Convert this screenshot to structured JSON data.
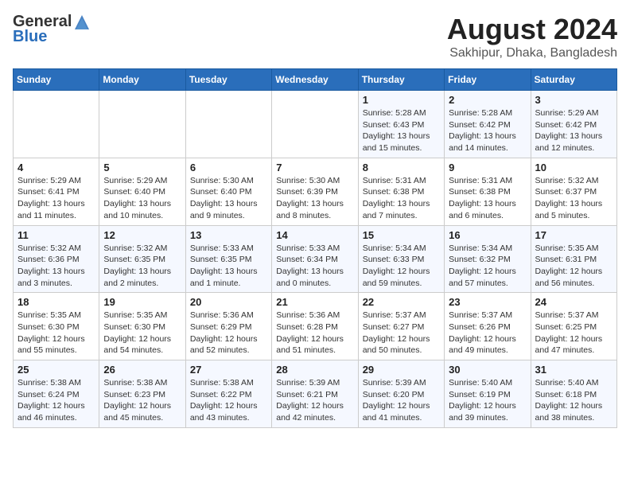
{
  "logo": {
    "general": "General",
    "blue": "Blue"
  },
  "title": "August 2024",
  "subtitle": "Sakhipur, Dhaka, Bangladesh",
  "days_of_week": [
    "Sunday",
    "Monday",
    "Tuesday",
    "Wednesday",
    "Thursday",
    "Friday",
    "Saturday"
  ],
  "weeks": [
    [
      {
        "day": "",
        "info": ""
      },
      {
        "day": "",
        "info": ""
      },
      {
        "day": "",
        "info": ""
      },
      {
        "day": "",
        "info": ""
      },
      {
        "day": "1",
        "info": "Sunrise: 5:28 AM\nSunset: 6:43 PM\nDaylight: 13 hours\nand 15 minutes."
      },
      {
        "day": "2",
        "info": "Sunrise: 5:28 AM\nSunset: 6:42 PM\nDaylight: 13 hours\nand 14 minutes."
      },
      {
        "day": "3",
        "info": "Sunrise: 5:29 AM\nSunset: 6:42 PM\nDaylight: 13 hours\nand 12 minutes."
      }
    ],
    [
      {
        "day": "4",
        "info": "Sunrise: 5:29 AM\nSunset: 6:41 PM\nDaylight: 13 hours\nand 11 minutes."
      },
      {
        "day": "5",
        "info": "Sunrise: 5:29 AM\nSunset: 6:40 PM\nDaylight: 13 hours\nand 10 minutes."
      },
      {
        "day": "6",
        "info": "Sunrise: 5:30 AM\nSunset: 6:40 PM\nDaylight: 13 hours\nand 9 minutes."
      },
      {
        "day": "7",
        "info": "Sunrise: 5:30 AM\nSunset: 6:39 PM\nDaylight: 13 hours\nand 8 minutes."
      },
      {
        "day": "8",
        "info": "Sunrise: 5:31 AM\nSunset: 6:38 PM\nDaylight: 13 hours\nand 7 minutes."
      },
      {
        "day": "9",
        "info": "Sunrise: 5:31 AM\nSunset: 6:38 PM\nDaylight: 13 hours\nand 6 minutes."
      },
      {
        "day": "10",
        "info": "Sunrise: 5:32 AM\nSunset: 6:37 PM\nDaylight: 13 hours\nand 5 minutes."
      }
    ],
    [
      {
        "day": "11",
        "info": "Sunrise: 5:32 AM\nSunset: 6:36 PM\nDaylight: 13 hours\nand 3 minutes."
      },
      {
        "day": "12",
        "info": "Sunrise: 5:32 AM\nSunset: 6:35 PM\nDaylight: 13 hours\nand 2 minutes."
      },
      {
        "day": "13",
        "info": "Sunrise: 5:33 AM\nSunset: 6:35 PM\nDaylight: 13 hours\nand 1 minute."
      },
      {
        "day": "14",
        "info": "Sunrise: 5:33 AM\nSunset: 6:34 PM\nDaylight: 13 hours\nand 0 minutes."
      },
      {
        "day": "15",
        "info": "Sunrise: 5:34 AM\nSunset: 6:33 PM\nDaylight: 12 hours\nand 59 minutes."
      },
      {
        "day": "16",
        "info": "Sunrise: 5:34 AM\nSunset: 6:32 PM\nDaylight: 12 hours\nand 57 minutes."
      },
      {
        "day": "17",
        "info": "Sunrise: 5:35 AM\nSunset: 6:31 PM\nDaylight: 12 hours\nand 56 minutes."
      }
    ],
    [
      {
        "day": "18",
        "info": "Sunrise: 5:35 AM\nSunset: 6:30 PM\nDaylight: 12 hours\nand 55 minutes."
      },
      {
        "day": "19",
        "info": "Sunrise: 5:35 AM\nSunset: 6:30 PM\nDaylight: 12 hours\nand 54 minutes."
      },
      {
        "day": "20",
        "info": "Sunrise: 5:36 AM\nSunset: 6:29 PM\nDaylight: 12 hours\nand 52 minutes."
      },
      {
        "day": "21",
        "info": "Sunrise: 5:36 AM\nSunset: 6:28 PM\nDaylight: 12 hours\nand 51 minutes."
      },
      {
        "day": "22",
        "info": "Sunrise: 5:37 AM\nSunset: 6:27 PM\nDaylight: 12 hours\nand 50 minutes."
      },
      {
        "day": "23",
        "info": "Sunrise: 5:37 AM\nSunset: 6:26 PM\nDaylight: 12 hours\nand 49 minutes."
      },
      {
        "day": "24",
        "info": "Sunrise: 5:37 AM\nSunset: 6:25 PM\nDaylight: 12 hours\nand 47 minutes."
      }
    ],
    [
      {
        "day": "25",
        "info": "Sunrise: 5:38 AM\nSunset: 6:24 PM\nDaylight: 12 hours\nand 46 minutes."
      },
      {
        "day": "26",
        "info": "Sunrise: 5:38 AM\nSunset: 6:23 PM\nDaylight: 12 hours\nand 45 minutes."
      },
      {
        "day": "27",
        "info": "Sunrise: 5:38 AM\nSunset: 6:22 PM\nDaylight: 12 hours\nand 43 minutes."
      },
      {
        "day": "28",
        "info": "Sunrise: 5:39 AM\nSunset: 6:21 PM\nDaylight: 12 hours\nand 42 minutes."
      },
      {
        "day": "29",
        "info": "Sunrise: 5:39 AM\nSunset: 6:20 PM\nDaylight: 12 hours\nand 41 minutes."
      },
      {
        "day": "30",
        "info": "Sunrise: 5:40 AM\nSunset: 6:19 PM\nDaylight: 12 hours\nand 39 minutes."
      },
      {
        "day": "31",
        "info": "Sunrise: 5:40 AM\nSunset: 6:18 PM\nDaylight: 12 hours\nand 38 minutes."
      }
    ]
  ]
}
